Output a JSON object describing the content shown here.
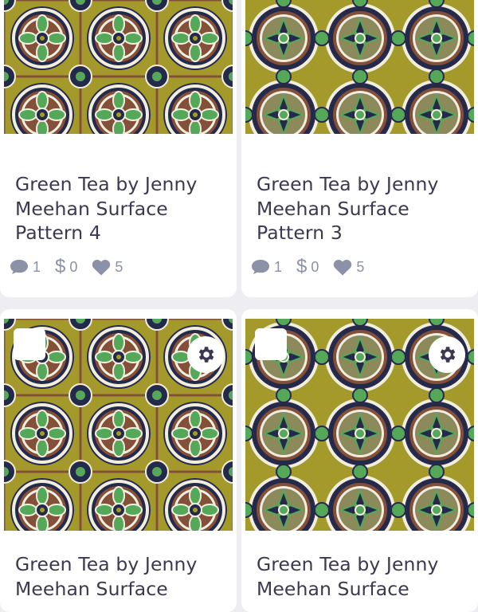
{
  "cards": [
    {
      "title": "Green Tea by Jenny Meehan Surface Pattern 4",
      "comments": "1",
      "price": "0",
      "likes": "5"
    },
    {
      "title": "Green Tea by Jenny Meehan Surface Pattern 3",
      "comments": "1",
      "price": "0",
      "likes": "5"
    },
    {
      "title": "Green Tea by Jenny Meehan Surface"
    },
    {
      "title": "Green Tea by Jenny Meehan Surface"
    }
  ],
  "icons": {
    "comment": "comment-icon",
    "price": "dollar-icon",
    "likes": "heart-icon",
    "settings": "gear-icon",
    "select": "checkbox"
  },
  "colors": {
    "background": "#eeeef2",
    "card": "#ffffff",
    "title_text": "#3d3850",
    "stat_text": "#8c91a8",
    "pattern_olive": "#a49a2c",
    "pattern_navy": "#262a4a",
    "pattern_brown": "#84503a",
    "pattern_green": "#55a85a",
    "pattern_cream": "#f1eee0"
  }
}
